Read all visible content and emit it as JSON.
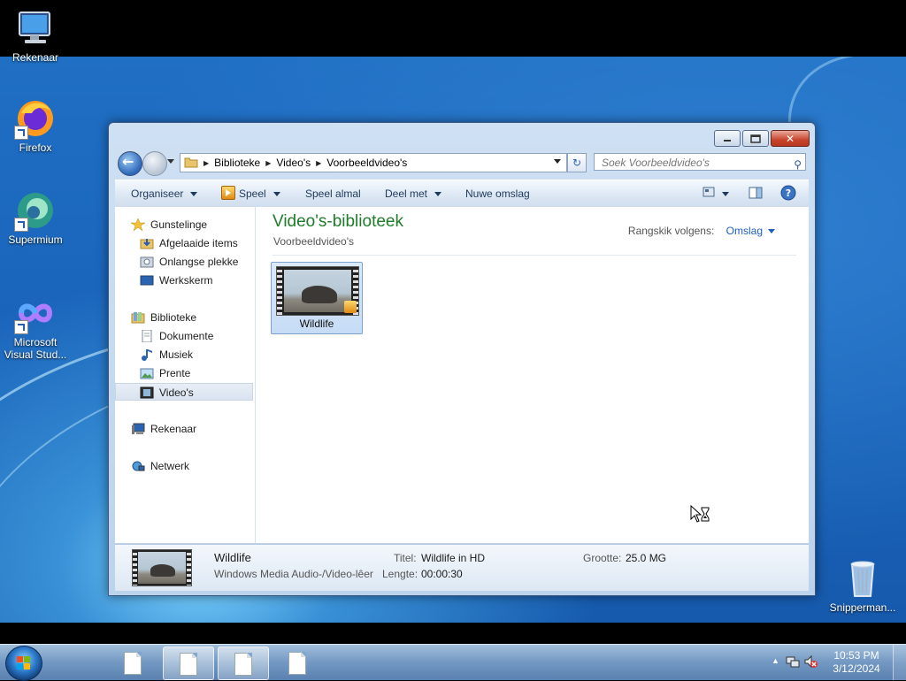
{
  "desktop": {
    "icons": [
      {
        "label": "Rekenaar",
        "icon": "computer-icon"
      },
      {
        "label": "Firefox",
        "icon": "firefox-icon"
      },
      {
        "label": "Supermium",
        "icon": "supermium-icon"
      },
      {
        "label_line1": "Microsoft",
        "label_line2": "Visual Stud...",
        "icon": "visual-studio-icon"
      },
      {
        "label": "Snipperman...",
        "icon": "recycle-bin-icon"
      }
    ]
  },
  "window": {
    "address": {
      "segments": [
        "Biblioteke",
        "Video's",
        "Voorbeeldvideo's"
      ]
    },
    "search": {
      "placeholder": "Soek Voorbeeldvideo's"
    },
    "toolbar": {
      "organise": "Organiseer",
      "play": "Speel",
      "play_all": "Speel almal",
      "share": "Deel met",
      "new_folder": "Nuwe omslag"
    },
    "nav": {
      "favorites": "Gunstelinge",
      "downloads": "Afgelaaide items",
      "recent": "Onlangse plekke",
      "desktop": "Werkskerm",
      "libraries": "Biblioteke",
      "documents": "Dokumente",
      "music": "Musiek",
      "pictures": "Prente",
      "videos": "Video's",
      "computer": "Rekenaar",
      "network": "Netwerk"
    },
    "main": {
      "title": "Video's-biblioteek",
      "subtitle": "Voorbeeldvideo's",
      "arrange_label": "Rangskik volgens:",
      "arrange_value": "Omslag",
      "files": [
        {
          "name": "Wildlife"
        }
      ]
    },
    "details": {
      "name": "Wildlife",
      "type": "Windows Media Audio-/Video-lêer",
      "title_label": "Titel:",
      "title_value": "Wildlife in HD",
      "length_label": "Lengte:",
      "length_value": "00:00:30",
      "size_label": "Grootte:",
      "size_value": "25.0 MG"
    }
  },
  "taskbar": {
    "time": "10:53 PM",
    "date": "3/12/2024"
  },
  "colors": {
    "library_title": "#1e7d2a",
    "link_blue": "#1f5fbf",
    "close_red": "#c8442c"
  }
}
